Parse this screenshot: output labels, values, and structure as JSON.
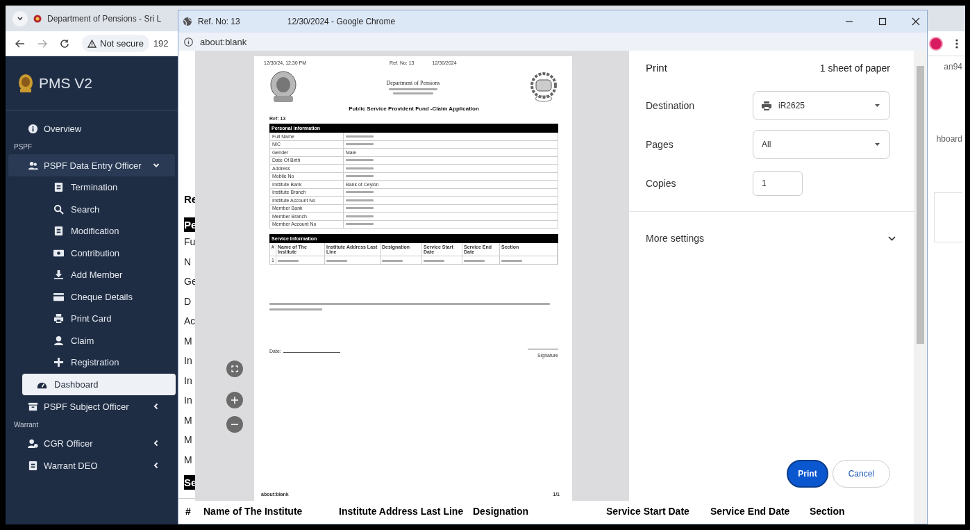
{
  "browser": {
    "tab_title": "Department of Pensions - Sri L",
    "security_label": "Not secure",
    "address": "192"
  },
  "sidebar": {
    "brand": "PMS V2",
    "items": [
      {
        "kind": "link",
        "label": "Overview"
      },
      {
        "kind": "header",
        "label": "PSPF"
      },
      {
        "kind": "group",
        "label": "PSPF Data Entry Officer",
        "expanded": true,
        "children": [
          {
            "label": "Termination",
            "selected": false
          },
          {
            "label": "Search",
            "selected": false
          },
          {
            "label": "Modification",
            "selected": false
          },
          {
            "label": "Contribution",
            "selected": false
          },
          {
            "label": "Add Member",
            "selected": false
          },
          {
            "label": "Cheque Details",
            "selected": false
          },
          {
            "label": "Print Card",
            "selected": false
          },
          {
            "label": "Claim",
            "selected": false
          },
          {
            "label": "Registration",
            "selected": false
          },
          {
            "label": "Dashboard",
            "selected": true
          }
        ]
      },
      {
        "kind": "group",
        "label": "PSPF Subject Officer",
        "expanded": false
      },
      {
        "kind": "header",
        "label": "Warrant"
      },
      {
        "kind": "group",
        "label": "CGR Officer",
        "expanded": false
      },
      {
        "kind": "group",
        "label": "Warrant DEO",
        "expanded": false
      }
    ]
  },
  "background_fragments": [
    "an94",
    "hboard"
  ],
  "popup": {
    "title": "Ref. No: 13",
    "subtitle": "12/30/2024 - Google Chrome",
    "address": "about:blank",
    "page_behind": {
      "heading": "Re",
      "section_1": "Pe",
      "rows": [
        "Fu",
        "N",
        "Ge",
        "D",
        "Ac",
        "M",
        "In",
        "In",
        "In",
        "M",
        "M",
        "M"
      ],
      "section_2": "Se",
      "table_columns": [
        "#",
        "Name of The Institute",
        "Institute Address Last Line",
        "Designation",
        "Service Start Date",
        "Service End Date",
        "Section"
      ]
    },
    "document": {
      "printed_at": "12/30/24, 12:30 PM",
      "ref_no": "Ref. No: 13",
      "date": "12/30/2024",
      "organization": "Department of Pensions",
      "title": "Public Service Provident Fund -Claim Application",
      "ref": "Ref: 13",
      "personal_heading": "Personal Information",
      "personal_rows": [
        {
          "label": "Full Name"
        },
        {
          "label": "NIC"
        },
        {
          "label": "Gender",
          "value": "Male"
        },
        {
          "label": "Date Of Birth"
        },
        {
          "label": "Address"
        },
        {
          "label": "Mobile No"
        },
        {
          "label": "Institute Bank",
          "value": "Bank of Ceylon"
        },
        {
          "label": "Institute Branch"
        },
        {
          "label": "Institute Account No"
        },
        {
          "label": "Member Bank"
        },
        {
          "label": "Member Branch"
        },
        {
          "label": "Member Account No"
        }
      ],
      "service_heading": "Service Information",
      "service_columns": [
        "#",
        "Name of The Institute",
        "Institute Address Last Line",
        "Designation",
        "Service Start Date",
        "Service End Date",
        "Section"
      ],
      "service_rows": [
        {
          "number": "1"
        }
      ],
      "date_label": "Date:",
      "signature_label": "Signature",
      "footer_url": "about:blank",
      "page_number": "1/1"
    },
    "print_settings": {
      "title": "Print",
      "sheets": "1 sheet of paper",
      "fields": [
        {
          "kind": "printer_select",
          "label": "Destination",
          "value": "iR2625"
        },
        {
          "kind": "select",
          "label": "Pages",
          "value": "All"
        },
        {
          "kind": "input",
          "label": "Copies",
          "value": "1"
        }
      ],
      "more_settings": "More settings",
      "more_expanded": false,
      "buttons": [
        {
          "label": "Print",
          "primary": true
        },
        {
          "label": "Cancel",
          "primary": false
        }
      ]
    }
  }
}
